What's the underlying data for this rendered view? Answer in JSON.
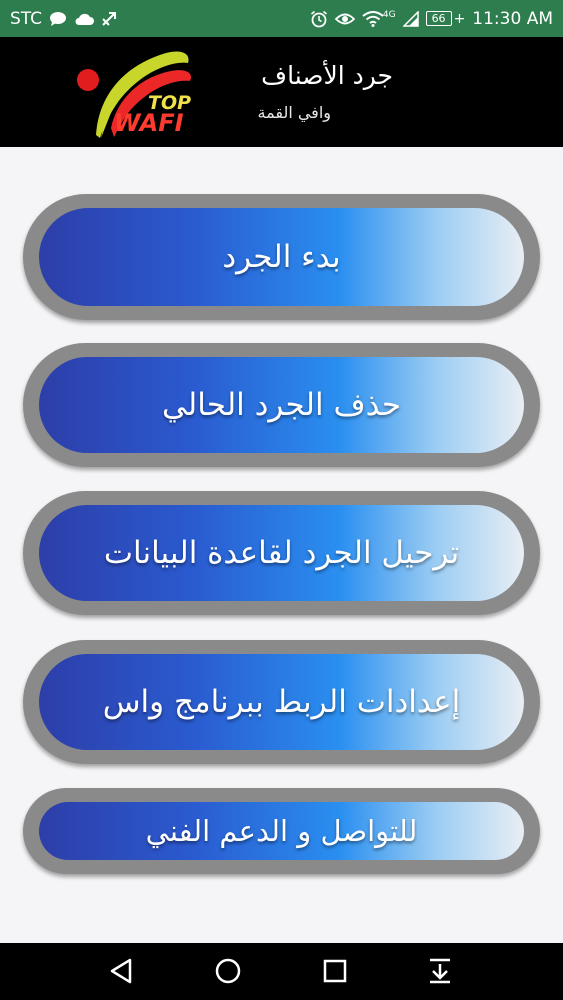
{
  "status_bar": {
    "carrier": "STC",
    "left_icons": [
      "chat-bubble-icon",
      "cloud-icon",
      "network-arrow-icon"
    ],
    "right_icons": [
      "alarm-icon",
      "eye-icon",
      "wifi-icon",
      "signal-icon"
    ],
    "network_type": "4G",
    "battery_level": "66",
    "time": "11:30 AM"
  },
  "header": {
    "logo_text_top": "TOP",
    "logo_text_bottom": "WAFI",
    "title": "جرد الأصناف",
    "subtitle": "وافي القمة"
  },
  "menu": {
    "items": [
      {
        "label": "بدء الجرد"
      },
      {
        "label": "حذف الجرد الحالي"
      },
      {
        "label": "ترحيل الجرد لقاعدة البيانات"
      },
      {
        "label": "إعدادات الربط ببرنامج واس"
      },
      {
        "label": "للتواصل و الدعم الفني"
      }
    ]
  },
  "navigation_bar": {
    "buttons": [
      "back-icon",
      "home-icon",
      "recents-icon",
      "notification-pull-icon"
    ]
  },
  "colors": {
    "status_bar": "#2e7d4f",
    "header_bg": "#000000",
    "button_frame": "#8a8a8a",
    "gradient_start": "#2d3ea8",
    "gradient_mid": "#2a8ff0",
    "gradient_end": "#e9eef4"
  }
}
